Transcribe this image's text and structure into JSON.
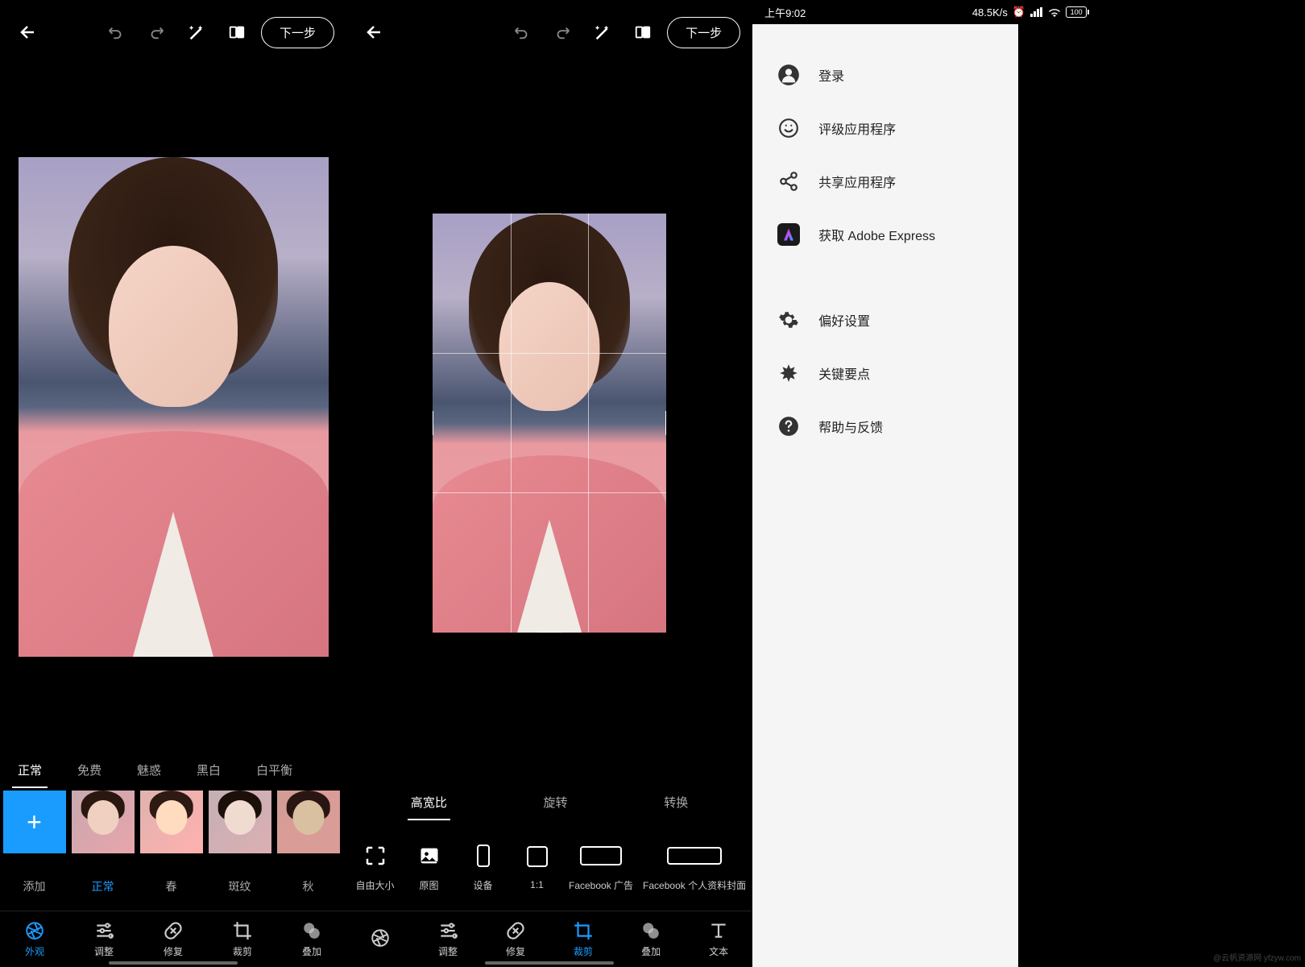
{
  "statusbar": {
    "time": "上午9:02",
    "speed": "48.5K/s",
    "battery": "100"
  },
  "topbar": {
    "next": "下一步"
  },
  "panel1": {
    "tabs": [
      "正常",
      "免费",
      "魅惑",
      "黑白",
      "白平衡"
    ],
    "active_tab": 0,
    "thumbs": [
      {
        "label": "添加",
        "kind": "add"
      },
      {
        "label": "正常",
        "kind": "normal",
        "active": true
      },
      {
        "label": "春",
        "kind": "warm"
      },
      {
        "label": "斑纹",
        "kind": "bw"
      },
      {
        "label": "秋",
        "kind": "autumn"
      }
    ],
    "nav": [
      {
        "label": "外观",
        "icon": "aperture",
        "active": true
      },
      {
        "label": "调整",
        "icon": "sliders"
      },
      {
        "label": "修复",
        "icon": "heal"
      },
      {
        "label": "裁剪",
        "icon": "crop"
      },
      {
        "label": "叠加",
        "icon": "overlay"
      }
    ]
  },
  "panel2": {
    "tabs": [
      "高宽比",
      "旋转",
      "转换"
    ],
    "active_tab": 0,
    "ratios": [
      {
        "label": "自由大小",
        "icon": "free"
      },
      {
        "label": "原图",
        "icon": "original"
      },
      {
        "label": "设备",
        "icon": "device"
      },
      {
        "label": "1:1",
        "icon": "square"
      },
      {
        "label": "Facebook 广告",
        "icon": "wide"
      },
      {
        "label": "Facebook 个人资料封面",
        "icon": "wider"
      }
    ],
    "nav": [
      {
        "label": "",
        "icon": "aperture"
      },
      {
        "label": "调整",
        "icon": "sliders"
      },
      {
        "label": "修复",
        "icon": "heal"
      },
      {
        "label": "裁剪",
        "icon": "crop",
        "active": true
      },
      {
        "label": "叠加",
        "icon": "overlay"
      },
      {
        "label": "文本",
        "icon": "text"
      }
    ]
  },
  "panel3": {
    "menu": [
      {
        "label": "登录",
        "icon": "person"
      },
      {
        "label": "评级应用程序",
        "icon": "smile"
      },
      {
        "label": "共享应用程序",
        "icon": "share"
      },
      {
        "label": "获取 Adobe Express",
        "icon": "adobe"
      },
      {
        "gap": true
      },
      {
        "label": "偏好设置",
        "icon": "gear"
      },
      {
        "label": "关键要点",
        "icon": "burst"
      },
      {
        "label": "帮助与反馈",
        "icon": "help"
      }
    ]
  },
  "watermark": "@云帆资源网 yfzyw.com"
}
